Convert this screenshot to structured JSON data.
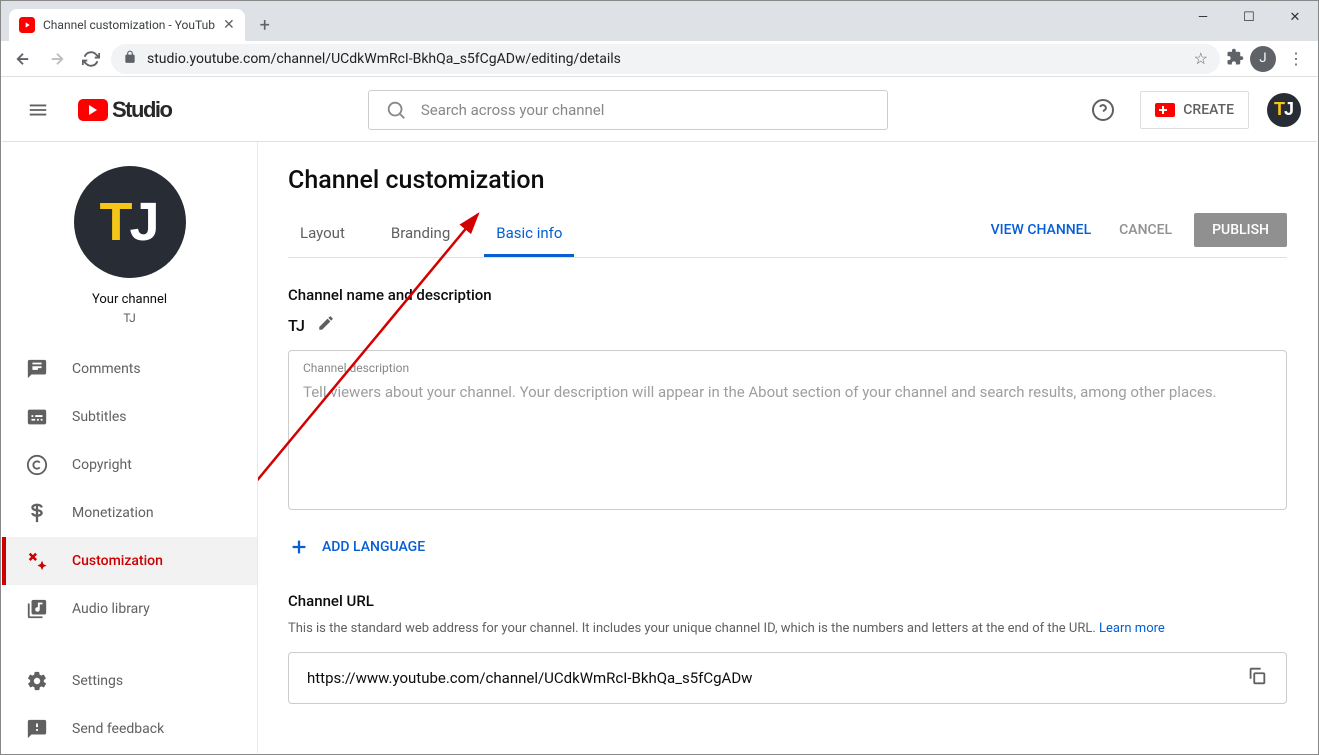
{
  "browser": {
    "tab_title": "Channel customization - YouTub",
    "url": "studio.youtube.com/channel/UCdkWmRcI-BkhQa_s5fCgADw/editing/details",
    "profile_initial": "J"
  },
  "header": {
    "logo_text": "Studio",
    "search_placeholder": "Search across your channel",
    "create_label": "CREATE"
  },
  "sidebar": {
    "your_channel_label": "Your channel",
    "channel_name": "TJ",
    "items": [
      {
        "label": "Comments"
      },
      {
        "label": "Subtitles"
      },
      {
        "label": "Copyright"
      },
      {
        "label": "Monetization"
      },
      {
        "label": "Customization"
      },
      {
        "label": "Audio library"
      }
    ],
    "footer": [
      {
        "label": "Settings"
      },
      {
        "label": "Send feedback"
      }
    ]
  },
  "main": {
    "title": "Channel customization",
    "tabs": [
      {
        "label": "Layout"
      },
      {
        "label": "Branding"
      },
      {
        "label": "Basic info"
      }
    ],
    "actions": {
      "view": "VIEW CHANNEL",
      "cancel": "CANCEL",
      "publish": "PUBLISH"
    },
    "name_section": {
      "heading": "Channel name and description",
      "channel_name": "TJ",
      "desc_label": "Channel description",
      "desc_placeholder": "Tell viewers about your channel. Your description will appear in the About section of your channel and search results, among other places."
    },
    "add_language": "ADD LANGUAGE",
    "url_section": {
      "heading": "Channel URL",
      "subtext": "This is the standard web address for your channel. It includes your unique channel ID, which is the numbers and letters at the end of the URL. ",
      "learn_more": "Learn more",
      "url_value": "https://www.youtube.com/channel/UCdkWmRcI-BkhQa_s5fCgADw"
    }
  }
}
